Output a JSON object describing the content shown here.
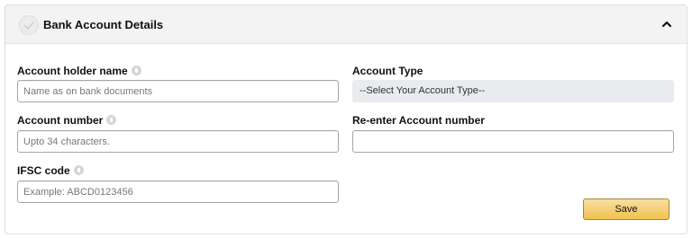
{
  "header": {
    "title": "Bank Account Details",
    "status_icon": "check-icon",
    "collapse_icon": "chevron-up-icon"
  },
  "form": {
    "account_holder": {
      "label": "Account holder name",
      "placeholder": "Name as on bank documents",
      "value": ""
    },
    "account_type": {
      "label": "Account Type",
      "selected": "--Select Your Account Type--"
    },
    "account_number": {
      "label": "Account number",
      "placeholder": "Upto 34 characters.",
      "value": ""
    },
    "reenter_account_number": {
      "label": "Re-enter Account number",
      "placeholder": "",
      "value": ""
    },
    "ifsc": {
      "label": "IFSC code",
      "placeholder": "Example: ABCD0123456",
      "value": ""
    }
  },
  "actions": {
    "save_label": "Save"
  },
  "colors": {
    "header_bg": "#f3f3f3",
    "select_bg": "#e9ebee",
    "button_top": "#f7dfa5",
    "button_bottom": "#f0c14b",
    "button_border": "#a88734"
  }
}
